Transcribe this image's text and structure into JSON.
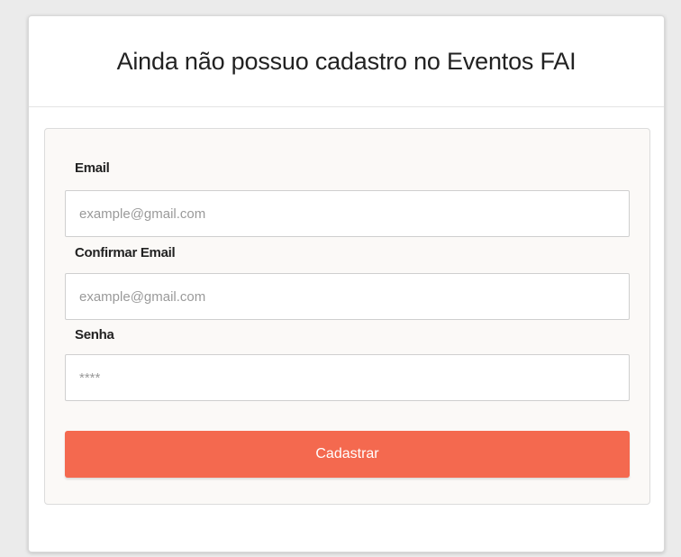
{
  "header": {
    "title": "Ainda não possuo cadastro no Eventos FAI"
  },
  "form": {
    "email_label": "Email",
    "email_placeholder": "example@gmail.com",
    "confirm_email_label": "Confirmar Email",
    "confirm_email_placeholder": "example@gmail.com",
    "password_label": "Senha",
    "password_placeholder": "****",
    "submit_label": "Cadastrar"
  },
  "colors": {
    "accent": "#f4694f",
    "panel_background": "#fbf9f7"
  }
}
